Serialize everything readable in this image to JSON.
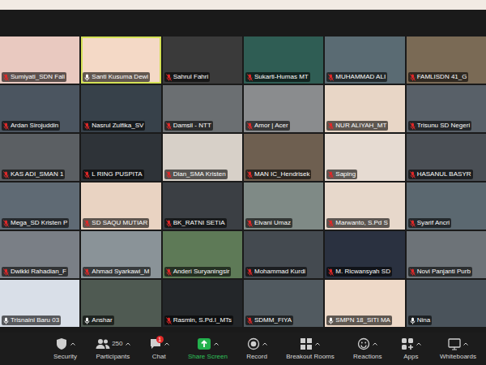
{
  "participants": [
    {
      "name": "Sumiyati_SDN Fali",
      "muted": true,
      "speaking": false
    },
    {
      "name": "Santi Kusuma Dewi",
      "muted": false,
      "speaking": true
    },
    {
      "name": "Sahrul Fahri",
      "muted": true,
      "speaking": false
    },
    {
      "name": "Sukarti-Humas MT",
      "muted": true,
      "speaking": false
    },
    {
      "name": "MUHAMMAD ALI",
      "muted": true,
      "speaking": false
    },
    {
      "name": "FAMLISDN 41_G",
      "muted": true,
      "speaking": false
    },
    {
      "name": "Ardan Sirojuddin",
      "muted": true,
      "speaking": false
    },
    {
      "name": "Nasrul Zulfika_SV",
      "muted": true,
      "speaking": false
    },
    {
      "name": "Damsil - NTT",
      "muted": true,
      "speaking": false
    },
    {
      "name": "Amor | Acer",
      "muted": true,
      "speaking": false
    },
    {
      "name": "NUR ALIYAH_MT",
      "muted": true,
      "speaking": false
    },
    {
      "name": "Trisunu SD Negeri",
      "muted": true,
      "speaking": false
    },
    {
      "name": "KAS ADI_SMAN 1",
      "muted": true,
      "speaking": false
    },
    {
      "name": "L RING PUSPITA",
      "muted": true,
      "speaking": false
    },
    {
      "name": "Dian_SMA Kristen",
      "muted": true,
      "speaking": false
    },
    {
      "name": "MAN IC_Hendrisek",
      "muted": true,
      "speaking": false
    },
    {
      "name": "Saping",
      "muted": true,
      "speaking": false
    },
    {
      "name": "HASANUL BASYR",
      "muted": true,
      "speaking": false
    },
    {
      "name": "Mega_SD Kristen P",
      "muted": true,
      "speaking": false
    },
    {
      "name": "SD SAQU MUTIAR",
      "muted": true,
      "speaking": false
    },
    {
      "name": "BK_RATNI SETIA",
      "muted": true,
      "speaking": false
    },
    {
      "name": "Elvani Umaz",
      "muted": true,
      "speaking": false
    },
    {
      "name": "Marwanto, S.Pd S",
      "muted": true,
      "speaking": false
    },
    {
      "name": "Syarif Ancri",
      "muted": true,
      "speaking": false
    },
    {
      "name": "Dwikki Rahadian_F",
      "muted": true,
      "speaking": false
    },
    {
      "name": "Ahmad Syarkawi_M",
      "muted": true,
      "speaking": false
    },
    {
      "name": "Anderi Suryaningsir",
      "muted": true,
      "speaking": false
    },
    {
      "name": "Mohammad Kurdi",
      "muted": true,
      "speaking": false
    },
    {
      "name": "M. Ricwansyah SD",
      "muted": true,
      "speaking": false
    },
    {
      "name": "Novi Panjanti Purb",
      "muted": true,
      "speaking": false
    },
    {
      "name": "Trisnaini Baru 03",
      "muted": false,
      "speaking": false
    },
    {
      "name": "Anshar",
      "muted": false,
      "speaking": false
    },
    {
      "name": "Rasmin, S.Pd.I_MTs",
      "muted": true,
      "speaking": false
    },
    {
      "name": "SDMM_FIYA",
      "muted": true,
      "speaking": false
    },
    {
      "name": "SMPN 18_SITI MA",
      "muted": false,
      "speaking": false
    },
    {
      "name": "Nina",
      "muted": false,
      "speaking": false
    }
  ],
  "toolbar": [
    {
      "label": "Security",
      "kind": "security"
    },
    {
      "label": "Participants",
      "kind": "participants",
      "count": "250"
    },
    {
      "label": "Chat",
      "kind": "chat",
      "badge": "1"
    },
    {
      "label": "Share Screen",
      "kind": "share"
    },
    {
      "label": "Record",
      "kind": "record"
    },
    {
      "label": "Breakout Rooms",
      "kind": "breakout"
    },
    {
      "label": "Reactions",
      "kind": "reactions"
    },
    {
      "label": "Apps",
      "kind": "apps"
    },
    {
      "label": "Whiteboards",
      "kind": "whiteboard"
    }
  ]
}
